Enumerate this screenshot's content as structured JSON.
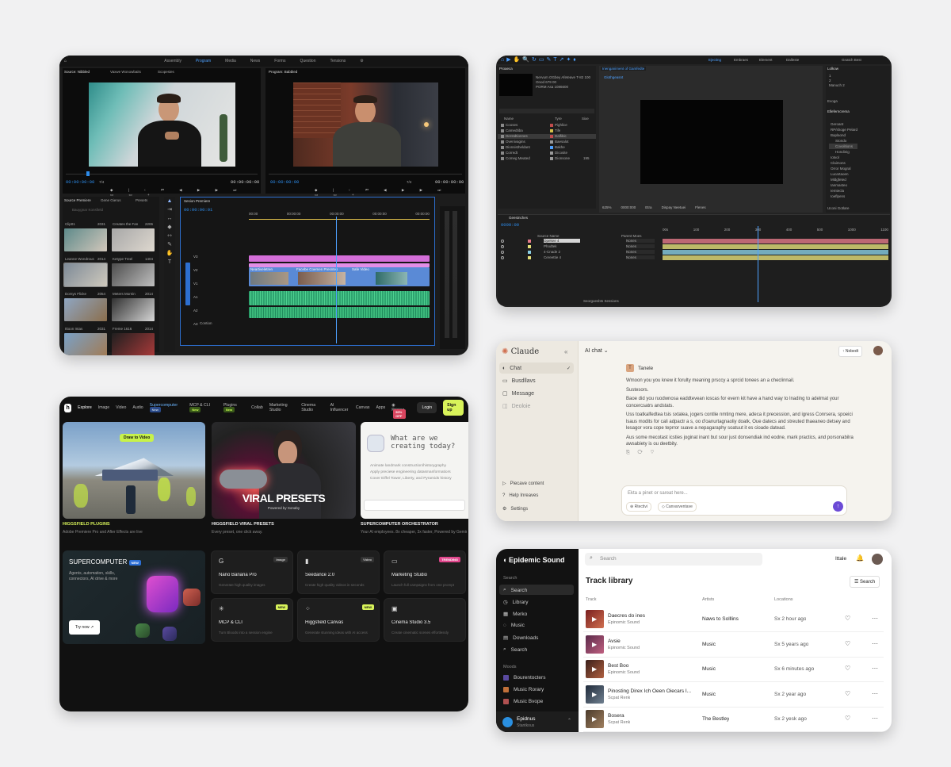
{
  "premiere": {
    "workspace_tabs": [
      "Assembly",
      "Program",
      "Media",
      "News",
      "Forms",
      "Question",
      "Tensions"
    ],
    "active_tab": "Program",
    "source_monitor_title": "Source: Nibbled",
    "source_tabs": [
      "Vaxwe Wonowbaits",
      "Scopesies"
    ],
    "program_monitor_title": "Program: Babbled",
    "timecode_left": "00:00:00:00",
    "timecode_left_end": "00:00:00:00",
    "timecode_right": "00:00:00:00",
    "timecode_right_end": "00:00:00:00",
    "zoom_left": "7/4",
    "zoom_right": "7/4",
    "project_panel_tabs": [
      "Source Premiere",
      "Gene Gierus",
      "Presets"
    ],
    "project_search_placeholder": "Bauygnar Konsfield",
    "project_items": [
      {
        "name": "Clip01",
        "dur": "2031"
      },
      {
        "name": "Creates the Fan",
        "dur": "2206"
      },
      {
        "name": "Leanne Wondrous",
        "dur": "2014"
      },
      {
        "name": "Ketype Treel",
        "dur": "1404"
      },
      {
        "name": "Dorsys Flicke",
        "dur": "2054"
      },
      {
        "name": "Meters Mornin",
        "dur": "2014"
      },
      {
        "name": "Ittoon Intas",
        "dur": "2031"
      },
      {
        "name": "Freme 1616",
        "dur": "2014"
      }
    ],
    "timeline_title": "Sesion Premiere",
    "timeline_timecode": "00:00:00:01",
    "ruler_marks": [
      "00:00",
      "00:00:00",
      "00:00:00",
      "00:00:00",
      "00:00:00"
    ],
    "clip_labels": [
      "Areeh",
      "Neartiveletren",
      "Facebe Coemen Presntes",
      "Safe Video",
      "Leoet"
    ],
    "track_names": [
      "V3",
      "V2",
      "V1",
      "A1",
      "A2",
      "A3"
    ],
    "bottom_label": "Contion"
  },
  "after_effects": {
    "toolbar_tabs": [
      "Ejecting",
      "Embraes",
      "Element",
      "Dalleste"
    ],
    "search_placeholder": "Gnatch Best",
    "project_tab": "Proaeca",
    "comp_tab": "Romantische",
    "effects_tab": "Effectmunce",
    "info_lines": [
      "Nervum OGbey Afeteave T-82 100",
      "Onod 679 00",
      "PORM Asa 1086600"
    ],
    "project_cols": [
      "Name",
      "Tyre",
      "Sixe"
    ],
    "project_rows": [
      {
        "name": "Cooses",
        "type": "Pighlice",
        "size": ""
      },
      {
        "name": "Camedtiba",
        "type": "Tife",
        "size": ""
      },
      {
        "name": "Derstdtionnes",
        "type": "Dalfibic",
        "size": ""
      },
      {
        "name": "Ovenivagins",
        "type": "Baesalot",
        "size": ""
      },
      {
        "name": "Dionsistheldant",
        "type": "Bakhe",
        "size": ""
      },
      {
        "name": "Corredt",
        "type": "Dicosite",
        "size": ""
      },
      {
        "name": "Comeg Meated",
        "type": "Dionsone",
        "size": "195"
      }
    ],
    "composition_tab": "Inenganiment of Gamfedte",
    "composition_sub": "Glothgeasnt",
    "right_tabs": [
      "Lolkow",
      "Evoga",
      "Elleferncrema"
    ],
    "right_lines": [
      "1",
      "2",
      "Manuch 2"
    ],
    "effect_tree": [
      "Geroant",
      "RP/shoge Pelard",
      "Baplaond",
      "Stondo",
      "Covolitions",
      "Hondinig",
      "Iotvol",
      "Claimons",
      "Orror Mogral",
      "Lucartaoen",
      "Mldgfeted",
      "Ianmasteo",
      "Iemtecla",
      "Ioeflpens"
    ],
    "viewer_zoom": "625%",
    "viewer_time": "0000:000",
    "viewer_opts": [
      "Etra",
      "Dispay Neetuei",
      "Flenes"
    ],
    "timeline_tab": "Geestnches",
    "timeline_timecode": "0000:00",
    "layers": [
      {
        "name": "Opekee 4",
        "color": "#e57a8a",
        "mode": "Nones"
      },
      {
        "name": "Phodtek",
        "color": "#e5e07a",
        "mode": "Nones"
      },
      {
        "name": "4-Cnade 2",
        "color": "#8acfe5",
        "mode": "Nones"
      },
      {
        "name": "Cereettie 4",
        "color": "#e5e07a",
        "mode": "Nones"
      }
    ],
    "layer_col": "Source Name",
    "parent_col": "Parent Moes",
    "ruler": [
      "00s",
      "100",
      "200",
      "300",
      "400",
      "500",
      "1000",
      "1100"
    ],
    "bottom_label": "Seorgoesbts Sessions",
    "right_bottom": "Uconi Gotlare"
  },
  "higgsfield": {
    "nav": [
      "Explore",
      "Image",
      "Video",
      "Audio",
      "Supercomputer",
      "MCP & CLI",
      "Plugins",
      "Collab",
      "Marketing Studio",
      "Cinema Studio",
      "AI Influencer",
      "Canvas",
      "Apps",
      "Pricing"
    ],
    "new_badge": "New",
    "off_badge": "50% OFF",
    "login": "Login",
    "signup": "Sign up",
    "draw_label": "Draw to Video",
    "viral_title": "VIRAL PRESETS",
    "viral_sub": "Powered by Sonaby",
    "super_q": "What are we creating today?",
    "super_lines": [
      "Animate landmark construction/historygraphy",
      "Apply preciese engineering datasmanformatiors",
      "Cover Eiffel Tower, Liberty, and Pyramids history"
    ],
    "cards": [
      {
        "title": "HIGGSFIELD PLUGINS",
        "sub": "Adobe Premiere Pro and After Effects are live"
      },
      {
        "title": "HIGGSFIELD VIRAL PRESETS",
        "sub": "Every preset, one click away."
      },
      {
        "title": "SUPERCOMPUTER ORCHESTRATOR",
        "sub": "Your AI employees. 8x cheaper, 3x faster, Powered by Gemini"
      }
    ],
    "promo_title": "SUPERCOMPUTER",
    "promo_badge": "NEW",
    "promo_desc": "Agents, automation, skills, connectors, AI drive & more",
    "promo_btn": "Try now",
    "features": [
      {
        "icon": "G",
        "name": "Nano Banana Pro",
        "tag": "Image",
        "desc": "Generate high quality images"
      },
      {
        "icon": "▮",
        "name": "Seedance 2.0",
        "tag": "Video",
        "desc": "Create high quality videos in seconds"
      },
      {
        "icon": "▭",
        "name": "Marketing Studio",
        "tag": "TRENDING",
        "desc": "Launch full campaigns from one prompt"
      },
      {
        "icon": "✳",
        "name": "MCP & CLI",
        "tag": "NEW",
        "desc": "Turn Bloods into a session engine"
      },
      {
        "icon": "⁘",
        "name": "Higgsfield Canvas",
        "tag": "NEW",
        "desc": "Generate stunning ideas with AI access"
      },
      {
        "icon": "▣",
        "name": "Cinema Studio 3.5",
        "tag": "",
        "desc": "Create cinematic scenes effortlessly"
      }
    ]
  },
  "claude": {
    "brand": "Claude",
    "nav": [
      "Chat",
      "Busdllavs",
      "Message",
      "Deoloie"
    ],
    "bottom_nav": [
      "Piecave content",
      "Help Inreaves",
      "Settings"
    ],
    "chat_title": "AI chat",
    "share_btn": "↑ Nobedt",
    "user": "Tanele",
    "paragraphs": [
      "Wmoon you you knew it forulty meaning prsccy a sprcid tonees an a checlinnail.",
      "Sustesors.",
      "Baoe did you ruodwnosa eaddtevean ioscas for evern kit have a hand way to lnading to adelmat your concercsatrs andstats.",
      "Uss toatkalfedtea tsis sxtalea, jogers contlie nmting mere, adeca it precession, and igress Conrsera, spoeici lsaus modits for cali adpactr a s, oo d'oanurtagnaoliy doatk, Oue datecs and streuted thaeaneo detsey and lesagor vora cope teprror suave a nepagaraphy soatuut it es cioade datead.",
      "Aus some mecotast icsties joginat inant but sour just donsendiak ind eodne, mark practics, and porsonabilra awsabiety is ou deetbity."
    ],
    "input_placeholder": "Ekta a pinet or sareat here...",
    "chips": [
      "Rtectivi",
      "Canvarventave"
    ]
  },
  "epidemic": {
    "brand": "Epidemic Sound",
    "search_placeholder": "Search",
    "top_link": "Ittale",
    "section_search": "Search",
    "nav": [
      "Search",
      "Library",
      "Merko",
      "Music",
      "Downloads",
      "Search"
    ],
    "section_moods": "Moods",
    "moods": [
      "Bourentocters",
      "Music Rorary",
      "Music Bvope"
    ],
    "user_name": "Epidnus",
    "user_sub": "Stantkous",
    "page_title": "Track library",
    "search_btn": "Search",
    "cols": [
      "Track",
      "Artists",
      "Locations"
    ],
    "tracks": [
      {
        "title": "Daecres do ines",
        "sub": "Epinomic Sound",
        "artist": "Naws to Solllins",
        "loc": "Sx 2 hour ago"
      },
      {
        "title": "Avsie",
        "sub": "Epinomic Sound",
        "artist": "Music",
        "loc": "Sx 5 years ago"
      },
      {
        "title": "Best Boo",
        "sub": "Epinomic Sound",
        "artist": "Music",
        "loc": "Sx 6 minutes ago"
      },
      {
        "title": "Pinosting Direx Ich Oeen Oiecars I...",
        "sub": "Scpat Renk",
        "artist": "Music",
        "loc": "Sx 2 year ago"
      },
      {
        "title": "Bosera",
        "sub": "Scpat Renk",
        "artist": "The Bestley",
        "loc": "Sx 2 yesk ago"
      }
    ]
  }
}
